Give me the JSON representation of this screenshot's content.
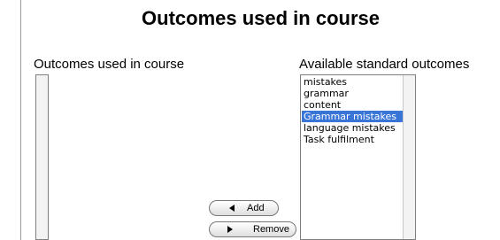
{
  "title": "Outcomes used in course",
  "left_column": {
    "label": "Outcomes used in course",
    "items": []
  },
  "right_column": {
    "label": "Available standard outcomes",
    "items": [
      {
        "label": "mistakes",
        "selected": false
      },
      {
        "label": "grammar",
        "selected": false
      },
      {
        "label": "content",
        "selected": false
      },
      {
        "label": "Grammar mistakes",
        "selected": true
      },
      {
        "label": "language mistakes",
        "selected": false
      },
      {
        "label": "Task fulfilment",
        "selected": false
      }
    ]
  },
  "buttons": {
    "add_label": "Add",
    "add_icon": "arrow-left-icon",
    "remove_label": "Remove",
    "remove_icon": "arrow-right-icon"
  },
  "colors": {
    "selection": "#3875d7"
  }
}
